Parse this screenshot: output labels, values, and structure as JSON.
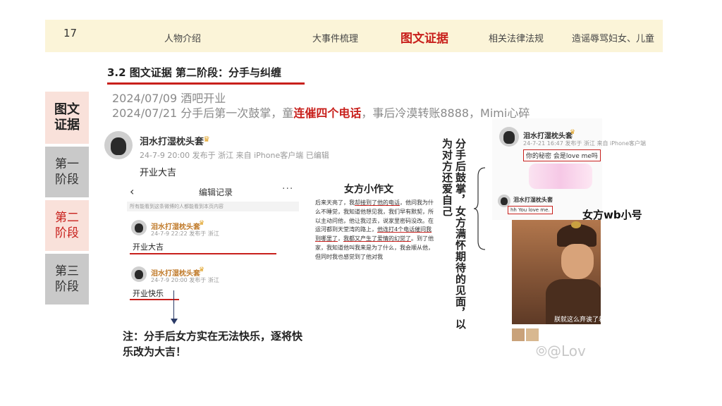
{
  "page_number": "17",
  "nav": {
    "item1": "人物介绍",
    "item2": "大事件梳理",
    "item3": "图文证据",
    "item4": "相关法律法规",
    "item5": "造谣辱骂妇女、儿童"
  },
  "section_title": "3.2 图文证据    第二阶段：分手与纠缠",
  "sidebar": {
    "s1": "图文\n证据",
    "s2": "第一\n阶段",
    "s3": "第二\n阶段",
    "s4": "第三\n阶段"
  },
  "timeline": {
    "line1": "2024/07/09   酒吧开业",
    "line2_pre": "2024/07/21   分手后第一次鼓掌，童",
    "line2_red": "连催四个电话",
    "line2_post": "，事后冷漠转账8888，Mimi心碎"
  },
  "post": {
    "name": "泪水打湿枕头套",
    "meta": "24-7-9 20:00  发布于 浙江  来自 iPhone客户端 已编辑",
    "text": "开业大吉"
  },
  "edit_record": {
    "title": "编辑记录",
    "hint": "所有能看到这条微博的人都能看到本页内容",
    "v1_name": "泪水打湿枕头套",
    "v1_meta": "24-7-9 22:22  发布于 浙江",
    "v1_text": "开业大吉",
    "v2_name": "泪水打湿枕头套",
    "v2_meta": "24-7-9 20:00  发布于 浙江",
    "v2_text": "开业快乐"
  },
  "note": "注：分手后女方实在无法快乐，逐将快乐改为大吉！",
  "essay": {
    "title": "女方小作文",
    "p1": "后来天亮了，我",
    "u1": "却接到了他的电话",
    "p2": "，他问我为什么不睡觉，我知道他想见我，我们早有默契，所以主动问他，他让我过去，说家里密码没改。在运河都到天堂湾的路上，",
    "u2": "他连打4个电话催问我到哪里了",
    "p3": "，",
    "u3": "我都又产生了爱情的幻觉了",
    "p4": "。到了他家，我知道他叫我来是为了什么，我会顺从他，但同时我也感觉到了他对我"
  },
  "vertical_caption": "分手后鼓掌，女方满怀期待的见面，以为对方还爱自己",
  "weibo_small": {
    "name1": "泪水打湿枕头套",
    "meta1": "24-7-21 16:47  发布于 浙江  来自 iPhone客户端",
    "quote1": "你的秘密 会是love me吗",
    "name2": "泪水打湿枕头套",
    "quote2": "hh You love me.",
    "label": "女方wb小号",
    "photo_caption": "朕就这么弃诶了着",
    "watermark": "@Lov"
  },
  "colors": {
    "accent_red": "#c8201c",
    "nav_bg": "#fbf4d8",
    "side_pink": "#f9e1da",
    "side_gray": "#c9c9c9"
  }
}
